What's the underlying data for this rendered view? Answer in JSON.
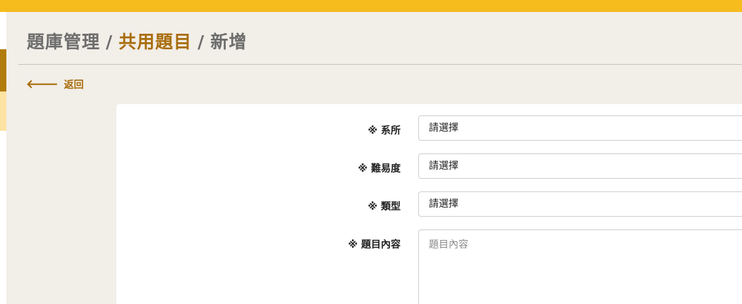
{
  "colors": {
    "accent": "#f6bb1d",
    "brand_dark": "#a86c0b",
    "background": "#f2eee8"
  },
  "breadcrumb": {
    "root": "題庫管理",
    "section": "共用題目",
    "current": "新增",
    "separator": "/"
  },
  "back": {
    "icon": "arrow-left-icon",
    "label": "返回"
  },
  "form": {
    "department": {
      "label": "※ 系所",
      "value": "請選擇"
    },
    "difficulty": {
      "label": "※ 難易度",
      "value": "請選擇"
    },
    "type": {
      "label": "※ 類型",
      "value": "請選擇"
    },
    "content": {
      "label": "※ 題目內容",
      "placeholder": "題目內容"
    }
  }
}
